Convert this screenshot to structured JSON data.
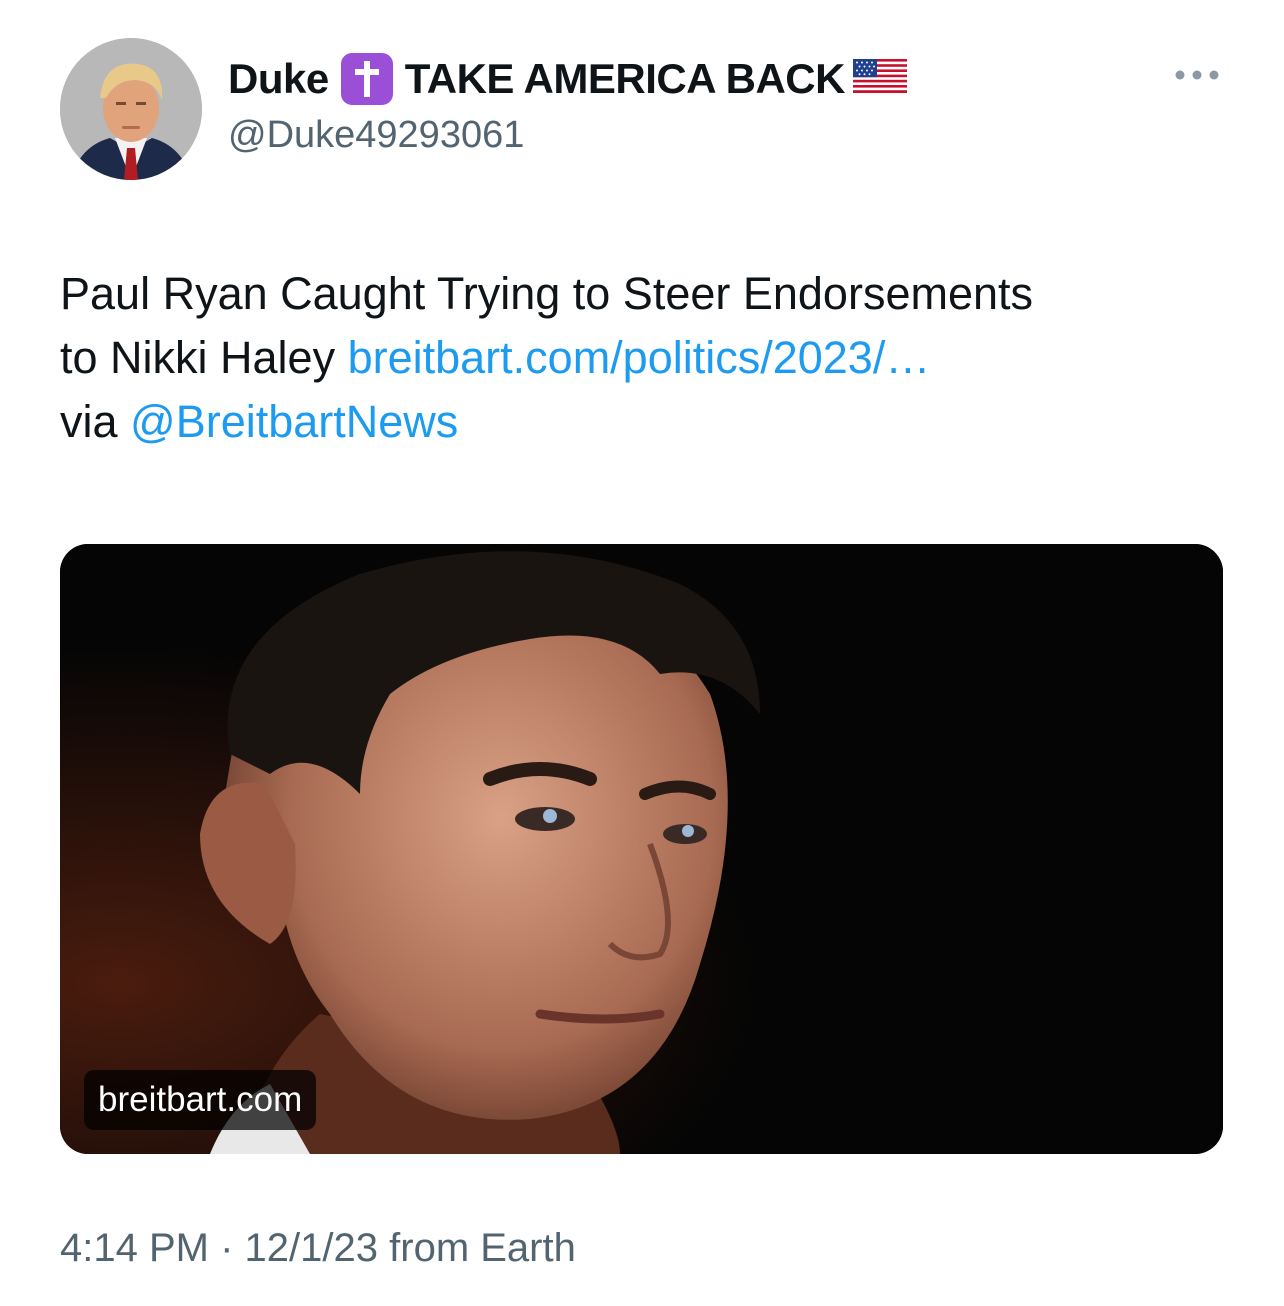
{
  "author": {
    "display_name_first": "Duke",
    "display_name_rest": "TAKE AMERICA BACK",
    "badge_icon": "latin-cross-emoji",
    "flag_icon": "us-flag-emoji",
    "handle": "@Duke49293061"
  },
  "menu": {
    "icon": "more-dots-icon"
  },
  "tweet": {
    "line1": "Paul Ryan Caught Trying to Steer Endorsements",
    "line2_prefix": "to Nikki Haley ",
    "link_url": "breitbart.com/politics/2023/…",
    "line3_prefix": "via ",
    "mention": "@BreitbartNews"
  },
  "card": {
    "domain": "breitbart.com"
  },
  "meta": {
    "time": "4:14 PM",
    "separator": "·",
    "date": "12/1/23",
    "source": "from Earth"
  },
  "colors": {
    "link": "#1d9bf0",
    "secondary_text": "#536471",
    "badge": "#9b4fd6"
  }
}
